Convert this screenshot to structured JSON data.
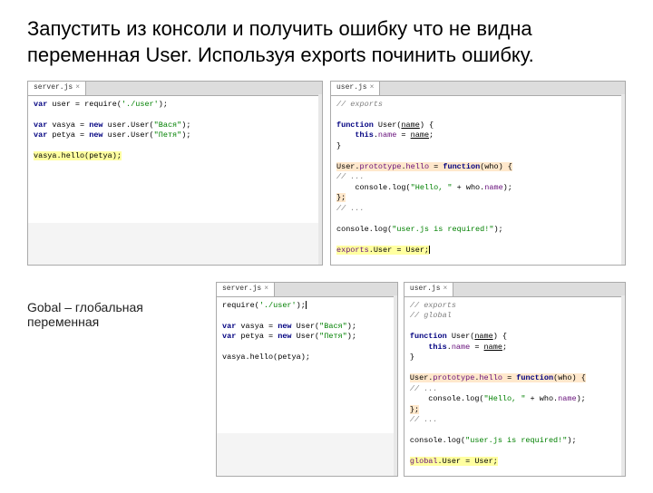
{
  "title": "Запустить из консоли и получить ошибку что не видна переменная User. Используя exports починить ошибку.",
  "caption": "Gobal – глобальная переменная",
  "pane1": {
    "tab": "server.js",
    "lines": [
      {
        "t": "var",
        "k": "kw"
      },
      {
        "t": " user = require("
      },
      {
        "t": "'./user'",
        "k": "str"
      },
      {
        "t": ");"
      },
      null,
      {
        "t": "var",
        "k": "kw"
      },
      {
        "t": " vasya = "
      },
      {
        "t": "new ",
        "k": "kw"
      },
      {
        "t": "user.User("
      },
      {
        "t": "\"Вася\"",
        "k": "str"
      },
      {
        "t": ");"
      },
      {
        "br": true
      },
      {
        "t": "var",
        "k": "kw"
      },
      {
        "t": " petya = "
      },
      {
        "t": "new ",
        "k": "kw"
      },
      {
        "t": "user.User("
      },
      {
        "t": "\"Петя\"",
        "k": "str"
      },
      {
        "t": ");"
      },
      {
        "br": true
      },
      null,
      {
        "t": "vasya.hello(petya);",
        "hl": true
      }
    ]
  },
  "pane2": {
    "tab": "user.js",
    "lines": [
      "// exports",
      "",
      "function User(name) {",
      "    this.name = name;",
      "}",
      "",
      "User.prototype.hello = function(who) {",
      "// ...",
      "    console.log(\"Hello, \" + who.name);",
      "};",
      "// ...",
      "",
      "console.log(\"user.js is required!\");",
      "",
      "exports.User = User;"
    ]
  },
  "pane3": {
    "tab": "server.js",
    "lines": [
      "require('./user');",
      "",
      "var vasya = new User(\"Вася\");",
      "var petya = new User(\"Петя\");",
      "",
      "vasya.hello(petya);"
    ]
  },
  "pane4": {
    "tab": "user.js",
    "lines": [
      "// exports",
      "// global",
      "",
      "function User(name) {",
      "    this.name = name;",
      "}",
      "",
      "User.prototype.hello = function(who) {",
      "// ...",
      "    console.log(\"Hello, \" + who.name);",
      "};",
      "// ...",
      "",
      "console.log(\"user.js is required!\");",
      "",
      "global.User = User;"
    ]
  }
}
